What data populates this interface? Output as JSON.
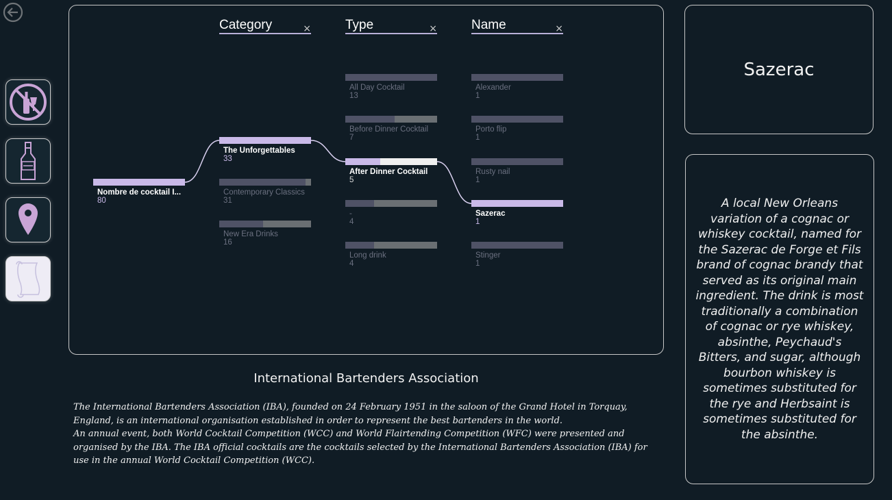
{
  "nav": {
    "back": {
      "icon": "back-arrow-icon"
    },
    "side_buttons": [
      {
        "icon": "no-alcohol-icon"
      },
      {
        "icon": "vodka-bottle-icon"
      },
      {
        "icon": "location-pin-icon"
      },
      {
        "icon": "scroll-icon",
        "active": true
      }
    ]
  },
  "tree": {
    "columns": [
      {
        "label": "Category",
        "close": "×"
      },
      {
        "label": "Type",
        "close": "×"
      },
      {
        "label": "Name",
        "close": "×"
      }
    ],
    "root": {
      "name": "Nombre de cocktail I...",
      "count": "80"
    },
    "categories": [
      {
        "name": "The Unforgettables",
        "count": "33",
        "state": "selected",
        "progress": 1.0
      },
      {
        "name": "Contemporary Classics",
        "count": "31",
        "state": "dim",
        "progress": 0.94
      },
      {
        "name": "New Era Drinks",
        "count": "16",
        "state": "dim",
        "progress": 0.48
      }
    ],
    "types": [
      {
        "name": "All Day Cocktail",
        "count": "13",
        "state": "dim",
        "progress": 1.0
      },
      {
        "name": "Before Dinner Cocktail",
        "count": "7",
        "state": "dim",
        "progress": 0.54
      },
      {
        "name": "After Dinner Cocktail",
        "count": "5",
        "state": "half",
        "progress": 0.38
      },
      {
        "name": "-",
        "count": "4",
        "state": "dim",
        "progress": 0.31
      },
      {
        "name": "Long drink",
        "count": "4",
        "state": "dim",
        "progress": 0.31
      }
    ],
    "names": [
      {
        "name": "Alexander",
        "count": "1",
        "state": "dim",
        "progress": 1.0
      },
      {
        "name": "Porto flip",
        "count": "1",
        "state": "dim",
        "progress": 1.0
      },
      {
        "name": "Rusty nail",
        "count": "1",
        "state": "dim",
        "progress": 1.0
      },
      {
        "name": "Sazerac",
        "count": "1",
        "state": "selected",
        "progress": 1.0
      },
      {
        "name": "Stinger",
        "count": "1",
        "state": "dim",
        "progress": 1.0
      }
    ]
  },
  "iba": {
    "title": "International Bartenders Association",
    "paragraph1": "The International Bartenders Association (IBA), founded on 24 February 1951 in the saloon of the Grand Hotel in Torquay, England, is an international organisation established in order to represent the best bartenders in the world.",
    "paragraph2": "An annual event, both World Cocktail Competition (WCC) and World Flairtending Competition (WFC) were presented and organised by the IBA. The IBA official cocktails are the cocktails selected by the International Bartenders Association (IBA) for use in the annual World Cocktail Competition (WCC)."
  },
  "cocktail": {
    "title": "Sazerac",
    "description": "A local New Orleans variation of a cognac or whiskey cocktail, named for the Sazerac de Forge et Fils brand of cognac brandy that served as its original main ingredient. The drink is most traditionally a combination of cognac or rye whiskey, absinthe, Peychaud's Bitters, and sugar, although bourbon whiskey is sometimes substituted for the rye and Herbsaint is sometimes substituted for the absinthe."
  },
  "colors": {
    "background": "#101c25",
    "accent": "#c9b9e8",
    "dim_bar": "#4f5266"
  }
}
